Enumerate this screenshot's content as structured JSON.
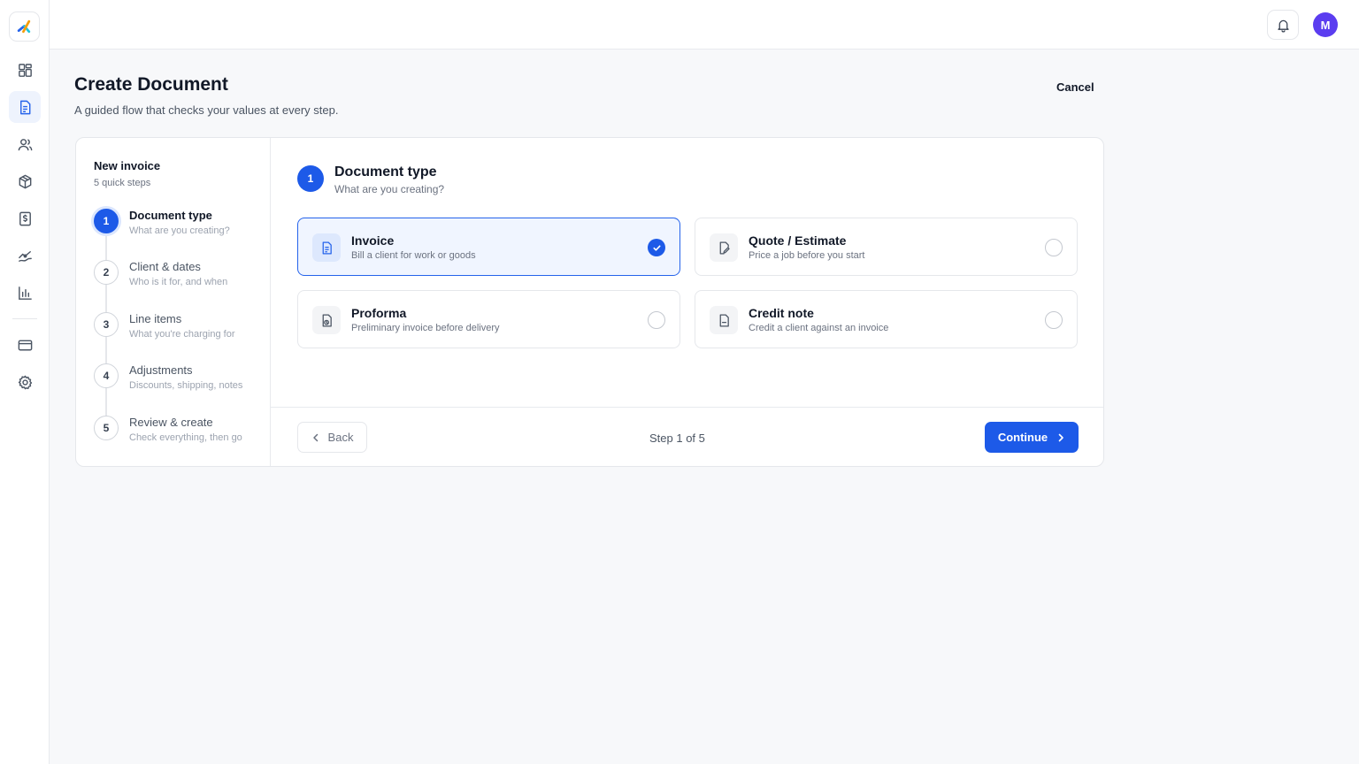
{
  "header": {
    "title": "Create Document",
    "subtitle": "A guided flow that checks your values at every step.",
    "cancel_label": "Cancel"
  },
  "topbar": {
    "avatar_initial": "M",
    "accent": "#5b3df0"
  },
  "sidebar": {
    "items": [
      {
        "icon": "dashboard-icon"
      },
      {
        "icon": "document-icon",
        "active": true
      },
      {
        "icon": "users-icon"
      },
      {
        "icon": "box-icon"
      },
      {
        "icon": "billing-icon"
      },
      {
        "icon": "payments-icon"
      },
      {
        "icon": "reports-icon"
      },
      {
        "icon": "card-icon"
      },
      {
        "icon": "settings-icon"
      }
    ]
  },
  "stepper": {
    "title": "New invoice",
    "subtitle": "5 quick steps",
    "steps": [
      {
        "num": "1",
        "label": "Document type",
        "desc": "What are you creating?"
      },
      {
        "num": "2",
        "label": "Client & dates",
        "desc": "Who is it for, and when"
      },
      {
        "num": "3",
        "label": "Line items",
        "desc": "What you're charging for"
      },
      {
        "num": "4",
        "label": "Adjustments",
        "desc": "Discounts, shipping, notes"
      },
      {
        "num": "5",
        "label": "Review & create",
        "desc": "Check everything, then go"
      }
    ]
  },
  "main": {
    "step_num": "1",
    "title": "Document type",
    "subtitle": "What are you creating?",
    "options": [
      {
        "title": "Invoice",
        "desc": "Bill a client for work or goods",
        "icon": "invoice-icon",
        "selected": true
      },
      {
        "title": "Quote / Estimate",
        "desc": "Price a job before you start",
        "icon": "quote-icon"
      },
      {
        "title": "Proforma",
        "desc": "Preliminary invoice before delivery",
        "icon": "proforma-icon"
      },
      {
        "title": "Credit note",
        "desc": "Credit a client against an invoice",
        "icon": "credit-note-icon"
      }
    ]
  },
  "footer": {
    "back_label": "Back",
    "step_indicator": "Step 1 of 5",
    "continue_label": "Continue"
  },
  "colors": {
    "primary": "#1d5ae8",
    "selected_bg": "#f0f5ff"
  }
}
